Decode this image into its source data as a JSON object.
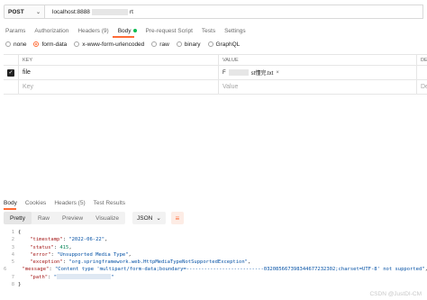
{
  "request": {
    "method": "POST",
    "url_prefix": "localhost:8888",
    "url_suffix": "rt"
  },
  "request_tabs": [
    {
      "label": "Params",
      "active": false
    },
    {
      "label": "Authorization",
      "active": false
    },
    {
      "label": "Headers (9)",
      "active": false
    },
    {
      "label": "Body",
      "active": true,
      "dot": true
    },
    {
      "label": "Pre-request Script",
      "active": false
    },
    {
      "label": "Tests",
      "active": false
    },
    {
      "label": "Settings",
      "active": false
    }
  ],
  "body_types": [
    {
      "label": "none",
      "selected": false
    },
    {
      "label": "form-data",
      "selected": true
    },
    {
      "label": "x-www-form-urlencoded",
      "selected": false
    },
    {
      "label": "raw",
      "selected": false
    },
    {
      "label": "binary",
      "selected": false
    },
    {
      "label": "GraphQL",
      "selected": false
    }
  ],
  "table": {
    "headers": [
      "KEY",
      "VALUE",
      "DESC"
    ],
    "rows": [
      {
        "key": "file",
        "value_prefix": "F",
        "value_suffix": "st懂完.txt",
        "remove": "×",
        "desc": "",
        "checked": true
      }
    ],
    "placeholder": {
      "key": "Key",
      "value": "Value",
      "desc": "Des-"
    }
  },
  "response_tabs": [
    {
      "label": "Body",
      "active": true
    },
    {
      "label": "Cookies",
      "active": false
    },
    {
      "label": "Headers (5)",
      "active": false
    },
    {
      "label": "Test Results",
      "active": false
    }
  ],
  "view_modes": [
    {
      "label": "Pretty",
      "active": true
    },
    {
      "label": "Raw",
      "active": false
    },
    {
      "label": "Preview",
      "active": false
    },
    {
      "label": "Visualize",
      "active": false
    }
  ],
  "format_select": {
    "value": "JSON",
    "chevron": "⌄"
  },
  "code_lines": [
    {
      "n": "1",
      "text": "{"
    },
    {
      "n": "2",
      "key": "\"timestamp\"",
      "val": "\"2022-06-22\"",
      "type": "s"
    },
    {
      "n": "3",
      "key": "\"status\"",
      "val": "415",
      "type": "n"
    },
    {
      "n": "4",
      "key": "\"error\"",
      "val": "\"Unsupported Media Type\"",
      "type": "s"
    },
    {
      "n": "5",
      "key": "\"exception\"",
      "val": "\"org.springframework.web.HttpMediaTypeNotSupportedException\"",
      "type": "s"
    },
    {
      "n": "6",
      "key": "\"message\"",
      "val": "\"Content type 'multipart/form-data;boundary=--------------------------032085667398344677232302;charset=UTF-8' not supported\"",
      "type": "s"
    },
    {
      "n": "7",
      "key": "\"path\"",
      "val": "\"",
      "type": "link"
    },
    {
      "n": "8",
      "text": "}"
    }
  ],
  "watermark": "CSDN @JustDI-CM",
  "colors": {
    "accent": "#ff6c37",
    "status_dot": "#0cbb52"
  }
}
